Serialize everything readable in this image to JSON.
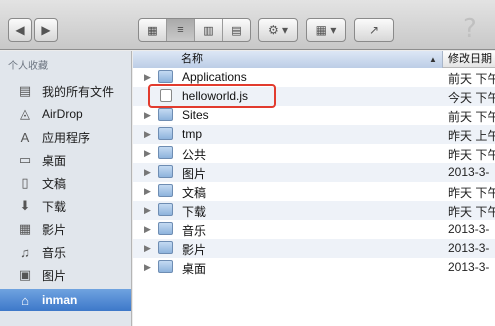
{
  "toolbar": {
    "back": "◀",
    "forward": "▶",
    "view_icons": "▦",
    "view_list": "≡",
    "view_columns": "▥",
    "view_coverflow": "▤",
    "action_icon": "⚙ ▾",
    "arrange_icon": "▦ ▾",
    "share_icon": "↗",
    "help": "?"
  },
  "sidebar": {
    "heading": "个人收藏",
    "items": [
      {
        "label": "我的所有文件",
        "icon": "all-files-icon",
        "glyph": "▤"
      },
      {
        "label": "AirDrop",
        "icon": "airdrop-icon",
        "glyph": "◬"
      },
      {
        "label": "应用程序",
        "icon": "applications-icon",
        "glyph": "A"
      },
      {
        "label": "桌面",
        "icon": "desktop-icon",
        "glyph": "▭"
      },
      {
        "label": "文稿",
        "icon": "documents-icon",
        "glyph": "▯"
      },
      {
        "label": "下载",
        "icon": "downloads-icon",
        "glyph": "⬇"
      },
      {
        "label": "影片",
        "icon": "movies-icon",
        "glyph": "▦"
      },
      {
        "label": "音乐",
        "icon": "music-icon",
        "glyph": "♫"
      },
      {
        "label": "图片",
        "icon": "pictures-icon",
        "glyph": "▣"
      },
      {
        "label": "inman",
        "icon": "home-icon",
        "glyph": "⌂"
      }
    ]
  },
  "list": {
    "col_name": "名称",
    "col_date": "修改日期",
    "rows": [
      {
        "name": "Applications",
        "date": "前天 下午",
        "folder": true
      },
      {
        "name": "helloworld.js",
        "date": "今天 下午",
        "folder": false
      },
      {
        "name": "Sites",
        "date": "前天 下午",
        "folder": true
      },
      {
        "name": "tmp",
        "date": "昨天 上午",
        "folder": true
      },
      {
        "name": "公共",
        "date": "昨天 下午",
        "folder": true
      },
      {
        "name": "图片",
        "date": "2013-3-",
        "folder": true
      },
      {
        "name": "文稿",
        "date": "昨天 下午",
        "folder": true
      },
      {
        "name": "下载",
        "date": "昨天 下午",
        "folder": true
      },
      {
        "name": "音乐",
        "date": "2013-3-",
        "folder": true
      },
      {
        "name": "影片",
        "date": "2013-3-",
        "folder": true
      },
      {
        "name": "桌面",
        "date": "2013-3-",
        "folder": true
      }
    ]
  }
}
